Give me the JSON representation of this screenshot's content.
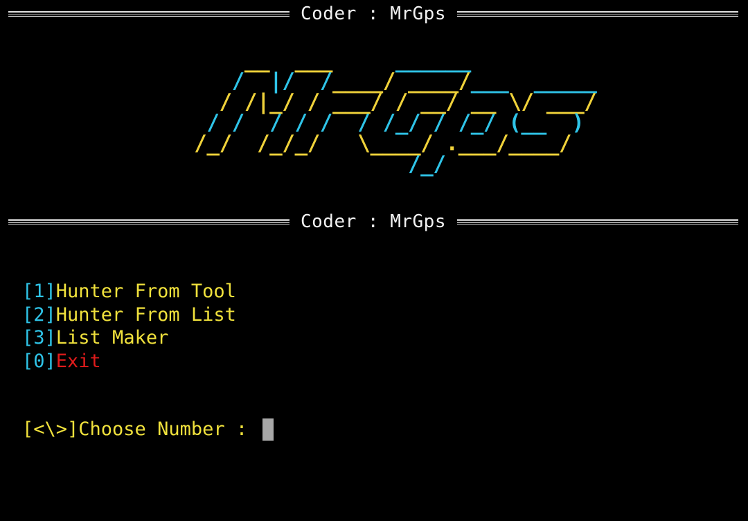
{
  "banner": {
    "title": "Coder : MrGps"
  },
  "logo": {
    "lines": [
      "     __  ___     ______",
      "    /  |/  /____/ ____/___  _____",
      "   / /|_/ / ___/ / __/ __ \\/ ___/",
      "  / /  / / /  / /_/ / /_/ (__  )",
      " /_/  /_/_/   \\____/ .___/____/",
      "                  /_/"
    ]
  },
  "menu": {
    "items": [
      {
        "key": "[1]",
        "label": "Hunter From Tool"
      },
      {
        "key": "[2]",
        "label": "Hunter From List"
      },
      {
        "key": "[3]",
        "label": "List Maker"
      },
      {
        "key": "[0]",
        "label": "Exit"
      }
    ]
  },
  "prompt": {
    "marker": "[<\\>]",
    "text": "Choose Number : "
  },
  "colors": {
    "background": "#000000",
    "cyan": "#2fc4e8",
    "yellow": "#f0e13c",
    "red": "#e01b1b",
    "rule": "#e8e8e8"
  }
}
